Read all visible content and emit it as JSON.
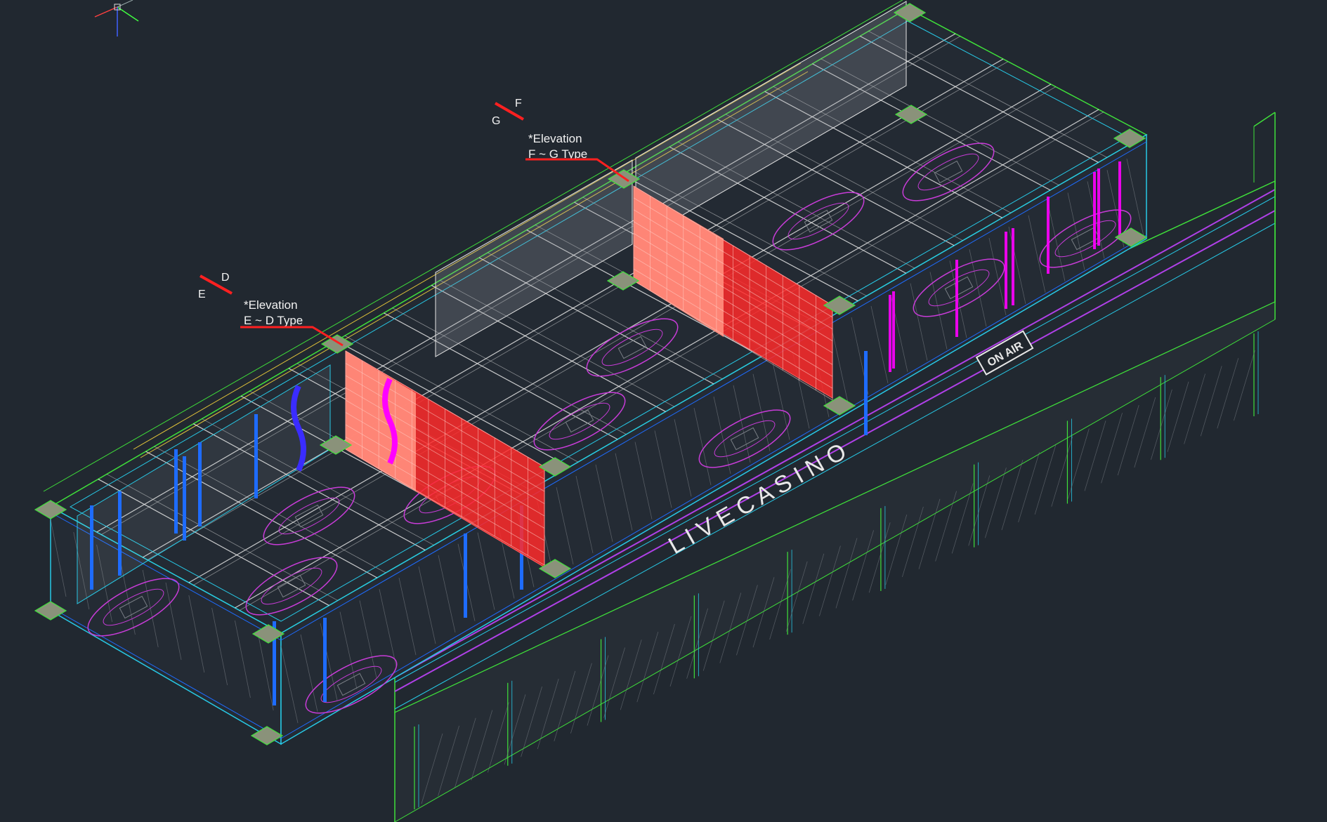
{
  "labels": {
    "section_ed": {
      "top": "D",
      "bottom": "E"
    },
    "section_fg": {
      "top": "F",
      "bottom": "G"
    },
    "elevation_ed": {
      "line1": "*Elevation",
      "line2": "E ~ D Type"
    },
    "elevation_fg": {
      "line1": "*Elevation",
      "line2": "F ~ G Type"
    }
  },
  "signage": {
    "main": "L I V E     C A S I N O",
    "badge": "ON AIR"
  },
  "icons": {
    "ucs": "ucs-axis-icon"
  },
  "colors": {
    "background": "#212830",
    "green": "#3fe03a",
    "cyan": "#27c9e6",
    "blue": "#1e6cff",
    "white": "#e6e6e6",
    "magenta": "#c83cd8",
    "red": "#ff2a2a",
    "salmon": "#ff7a6a",
    "yellow": "#e0c23a",
    "gray": "#7a7f86"
  }
}
